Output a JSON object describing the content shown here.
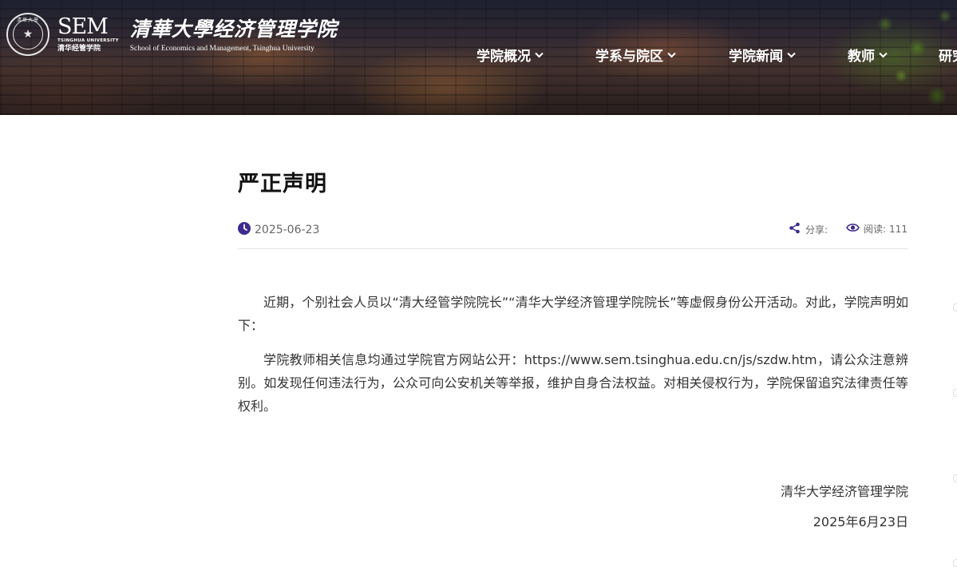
{
  "header": {
    "logo": {
      "seal_text": "清華大學",
      "sem": "SEM",
      "sem_sub_en": "TSINGHUA UNIVERSITY",
      "sem_sub_cn": "清华经管学院",
      "cn_name": "清華大學经济管理学院",
      "en_name": "School of Economics and Management, Tsinghua University"
    },
    "nav": [
      {
        "label": "学院概况",
        "icon": "chevron-down-icon"
      },
      {
        "label": "学系与院区",
        "icon": "chevron-down-icon"
      },
      {
        "label": "学院新闻",
        "icon": "chevron-down-icon"
      },
      {
        "label": "教师",
        "icon": "chevron-down-icon"
      },
      {
        "label": "研究"
      }
    ],
    "colors": {
      "nav_text": "#ffffff"
    }
  },
  "article": {
    "title": "严正声明",
    "date": "2025-06-23",
    "share_label": "分享:",
    "views_label": "阅读:",
    "views_count": "111",
    "accent": "#3d2b8f",
    "paragraphs": [
      "近期，个别社会人员以“清大经管学院院长”“清华大学经济管理学院院长”等虚假身份公开活动。对此，学院声明如下：",
      "学院教师相关信息均通过学院官方网站公开：https://www.sem.tsinghua.edu.cn/js/szdw.htm，请公众注意辨别。如发现任何违法行为，公众可向公安机关等举报，维护自身合法权益。对相关侵权行为，学院保留追究法律责任等权利。"
    ],
    "signature_org": "清华大学经济管理学院",
    "signature_date": "2025年6月23日"
  }
}
